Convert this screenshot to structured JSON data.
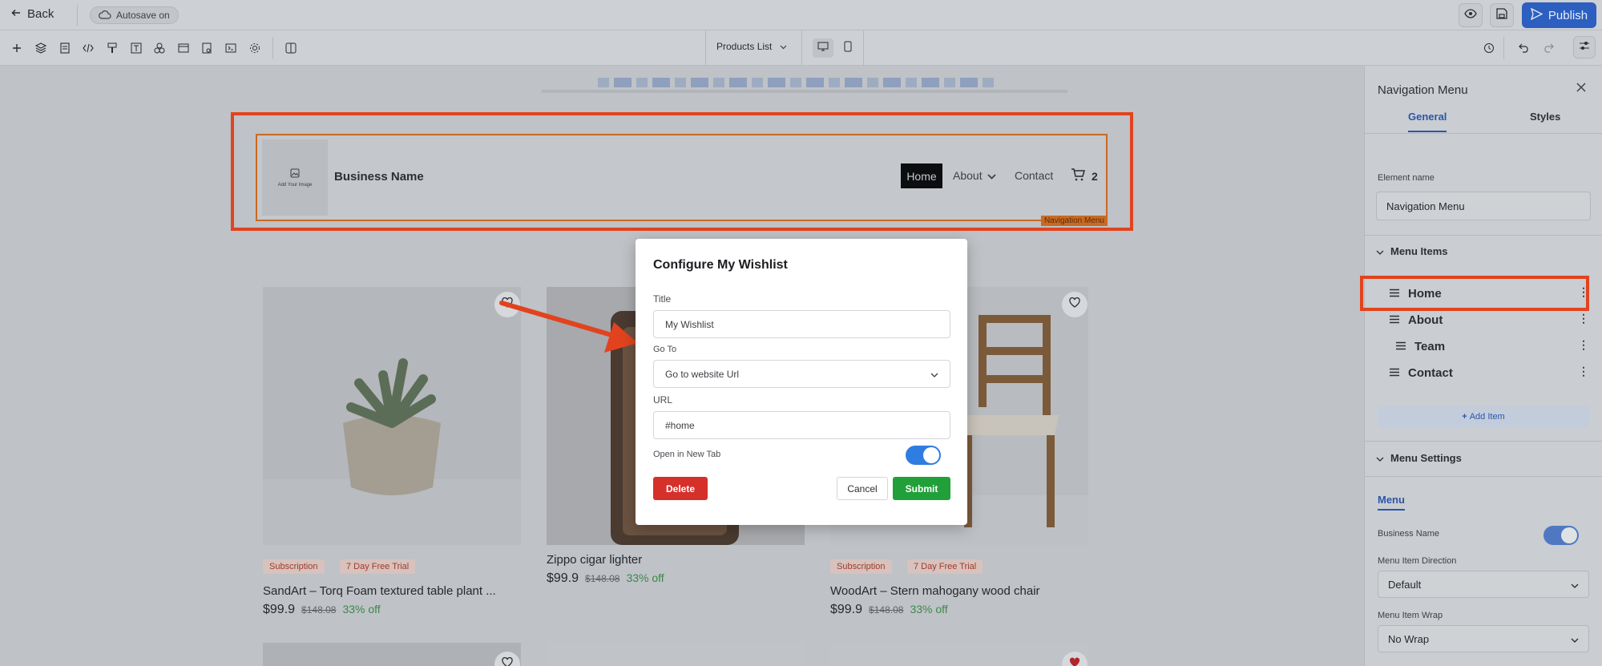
{
  "topbar": {
    "back_label": "Back",
    "autosave_label": "Autosave on",
    "publish_label": "Publish"
  },
  "toolbar": {
    "page_name": "Products List"
  },
  "canvas": {
    "header": {
      "logo_placeholder": "Add Your Image",
      "business_name": "Business Name",
      "nav_items": [
        "Home",
        "About",
        "Contact"
      ],
      "cart_count": "2",
      "element_tag": "Navigation Menu"
    },
    "products": [
      {
        "badges": [
          "Subscription",
          "7 Day Free Trial"
        ],
        "title": "SandArt – Torq Foam textured table plant ...",
        "price": "$99.9",
        "old_price": "$148.08",
        "discount": "33% off"
      },
      {
        "badges": [],
        "title": "Zippo cigar lighter",
        "price": "$99.9",
        "old_price": "$148.08",
        "discount": "33% off"
      },
      {
        "badges": [
          "Subscription",
          "7 Day Free Trial"
        ],
        "title": "WoodArt – Stern mahogany wood chair",
        "price": "$99.9",
        "old_price": "$148.08",
        "discount": "33% off"
      }
    ]
  },
  "modal": {
    "title": "Configure My Wishlist",
    "title_label": "Title",
    "title_value": "My Wishlist",
    "goto_label": "Go To",
    "goto_value": "Go to website Url",
    "url_label": "URL",
    "url_value": "#home",
    "new_tab_label": "Open in New Tab",
    "new_tab_enabled": true,
    "delete_label": "Delete",
    "cancel_label": "Cancel",
    "submit_label": "Submit"
  },
  "panel": {
    "title": "Navigation Menu",
    "tabs": [
      "General",
      "Styles"
    ],
    "element_name_label": "Element name",
    "element_name_value": "Navigation Menu",
    "menu_items_heading": "Menu Items",
    "menu_items": [
      "Home",
      "About",
      "Team",
      "Contact"
    ],
    "add_item_label": "Add Item",
    "menu_settings_heading": "Menu Settings",
    "settings_tab": "Menu",
    "business_name_label": "Business Name",
    "business_name_enabled": true,
    "direction_label": "Menu Item Direction",
    "direction_value": "Default",
    "wrap_label": "Menu Item Wrap",
    "wrap_value": "No Wrap"
  },
  "colors": {
    "accent": "#2c56a8",
    "highlight": "#e2431e",
    "publish": "#2c5fc0",
    "delete": "#d6302b",
    "submit": "#21a03a"
  }
}
